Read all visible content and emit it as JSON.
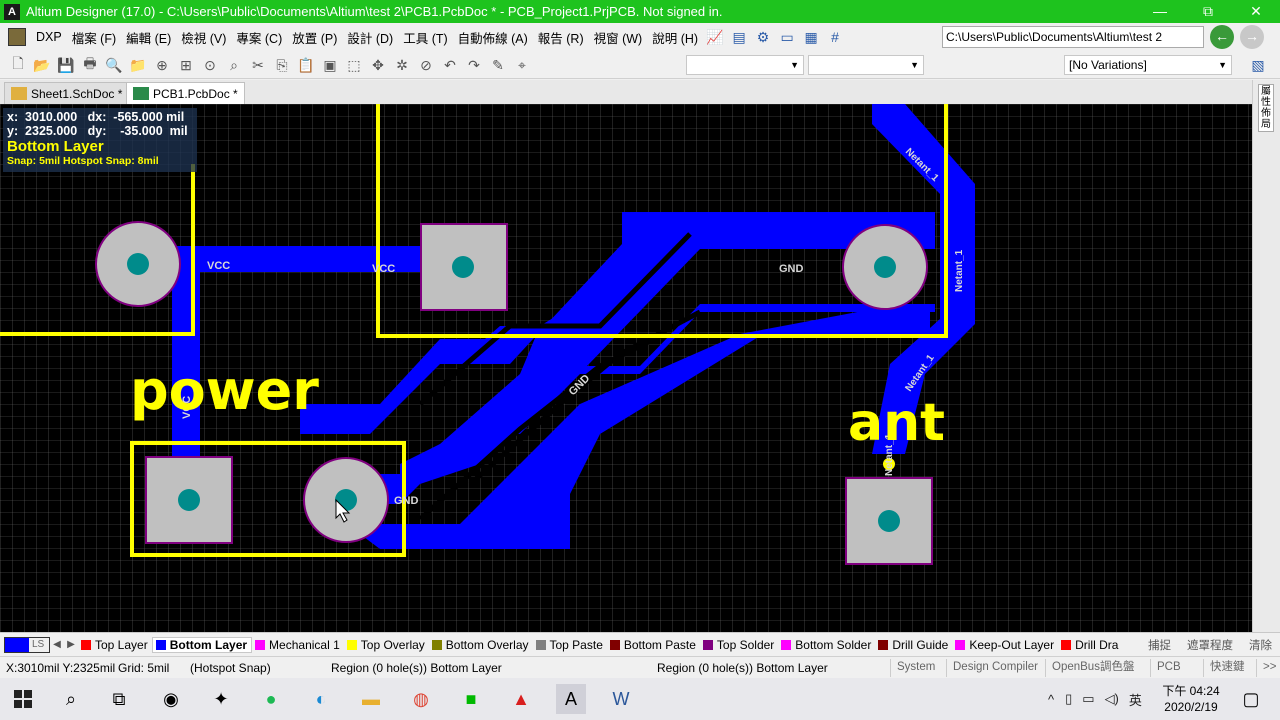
{
  "window": {
    "app_icon": "altium-logo-icon",
    "title": "Altium Designer (17.0) - C:\\Users\\Public\\Documents\\Altium\\test 2\\PCB1.PcbDoc * - PCB_Project1.PrjPCB. Not signed in.",
    "minimize": "—",
    "restore": "⧉",
    "close": "✕"
  },
  "menu": {
    "dxp": "DXP",
    "items": [
      "檔案 (F)",
      "編輯 (E)",
      "檢視 (V)",
      "專案 (C)",
      "放置 (P)",
      "設計 (D)",
      "工具 (T)",
      "自動佈線 (A)",
      "報告 (R)",
      "視窗 (W)",
      "說明 (H)"
    ],
    "path": "C:\\Users\\Public\\Documents\\Altium\\test 2"
  },
  "toolbar": {
    "combo1": "",
    "combo2": "",
    "variations": "[No Variations]"
  },
  "tabs": [
    {
      "label": "Sheet1.SchDoc *",
      "active": false
    },
    {
      "label": "PCB1.PcbDoc *",
      "active": true
    }
  ],
  "rightbar": {
    "label": "屬性佈局"
  },
  "hud": {
    "line1": "x:  3010.000   dx:  -565.000 mil",
    "line2": "y:  2325.000   dy:    -35.000  mil",
    "layer": "Bottom Layer",
    "snap": "Snap: 5mil Hotspot Snap: 8mil"
  },
  "pcb": {
    "labels": {
      "vcc1": "VCC",
      "vcc2": "VCC",
      "vcc3": "VCC",
      "gnd1": "GND",
      "gnd2": "GND",
      "gnd3": "GND",
      "netant1": "Netant_1",
      "netant2": "Netant_1",
      "netant3": "Netant_1",
      "netant4": "Netant_1",
      "power": "power",
      "ant": "ant"
    }
  },
  "layers": {
    "ls_label": "LS",
    "items": [
      {
        "name": "Top Layer",
        "color": "#ff0000"
      },
      {
        "name": "Bottom Layer",
        "color": "#0000ff",
        "active": true
      },
      {
        "name": "Mechanical 1",
        "color": "#ff00ff"
      },
      {
        "name": "Top Overlay",
        "color": "#ffff00"
      },
      {
        "name": "Bottom Overlay",
        "color": "#808000"
      },
      {
        "name": "Top Paste",
        "color": "#808080"
      },
      {
        "name": "Bottom Paste",
        "color": "#800000"
      },
      {
        "name": "Top Solder",
        "color": "#800080"
      },
      {
        "name": "Bottom Solder",
        "color": "#ff00ff"
      },
      {
        "name": "Drill Guide",
        "color": "#800000"
      },
      {
        "name": "Keep-Out Layer",
        "color": "#ff00ff"
      },
      {
        "name": "Drill Dra",
        "color": "#ff0000"
      }
    ],
    "right": [
      "捕捉",
      "遮罩程度",
      "清除"
    ]
  },
  "status": {
    "coords": "X:3010mil Y:2325mil",
    "grid": "Grid: 5mil",
    "hotspot": "(Hotspot Snap)",
    "region1": "Region (0 hole(s)) Bottom Layer",
    "region2": "Region (0 hole(s)) Bottom Layer",
    "panels": [
      "System",
      "Design Compiler",
      "OpenBus調色盤",
      "PCB",
      "快速鍵",
      ">>"
    ]
  },
  "taskbar": {
    "icons": [
      "windows-start-icon",
      "search-icon",
      "task-view-icon",
      "app-icon",
      "app-icon",
      "spotify-icon",
      "edge-icon",
      "file-explorer-icon",
      "chrome-icon",
      "line-icon",
      "acrobat-icon",
      "altium-icon",
      "word-icon"
    ],
    "ime": "英",
    "time": "下午 04:24",
    "date": "2020/2/19"
  }
}
